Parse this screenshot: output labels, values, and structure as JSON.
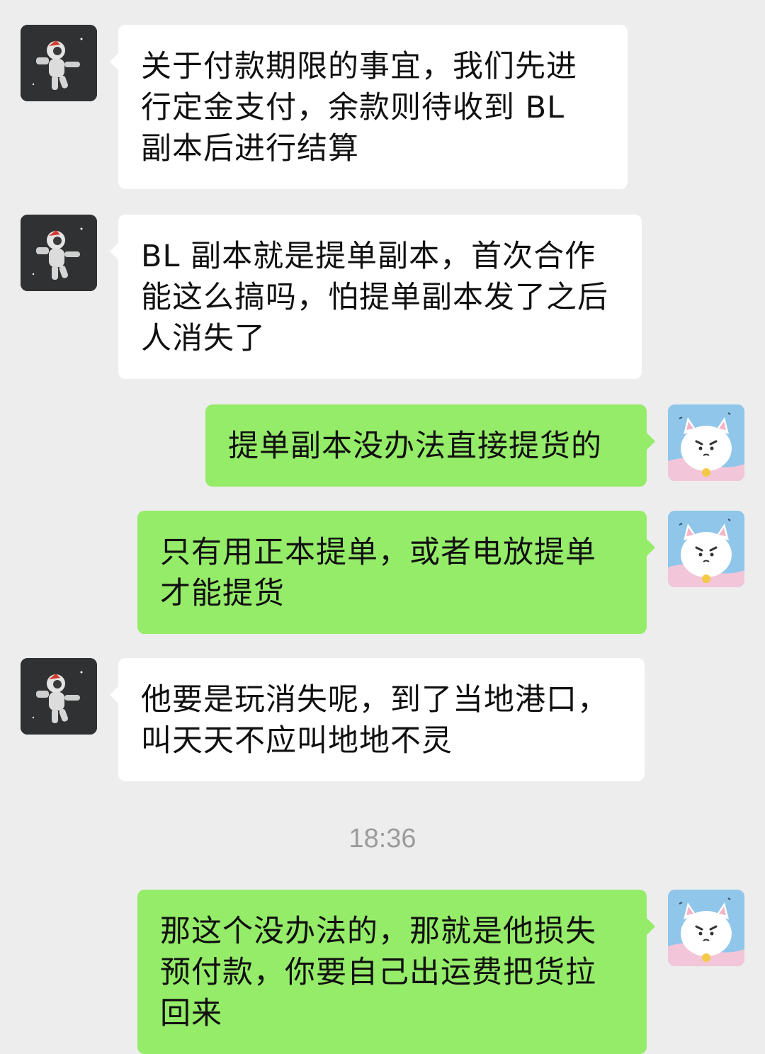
{
  "chat": {
    "messages": [
      {
        "sender": "other",
        "avatar": "astronaut-avatar",
        "text": "关于付款期限的事宜，我们先进行定金支付，余款则待收到 BL 副本后进行结算"
      },
      {
        "sender": "other",
        "avatar": "astronaut-avatar",
        "text": "BL 副本就是提单副本，首次合作能这么搞吗，怕提单副本发了之后人消失了"
      },
      {
        "sender": "self",
        "avatar": "cat-avatar",
        "text": "提单副本没办法直接提货的"
      },
      {
        "sender": "self",
        "avatar": "cat-avatar",
        "text": "只有用正本提单，或者电放提单才能提货"
      },
      {
        "sender": "other",
        "avatar": "astronaut-avatar",
        "text": "他要是玩消失呢，到了当地港口，叫天天不应叫地地不灵"
      },
      {
        "sender": "self",
        "avatar": "cat-avatar",
        "text": "那这个没办法的，那就是他损失预付款，你要自己出运费把货拉回来"
      }
    ],
    "timestamp": "18:36"
  },
  "colors": {
    "background": "#ededed",
    "incoming_bubble": "#ffffff",
    "outgoing_bubble": "#95ec69",
    "timestamp_text": "#9b9b9b"
  }
}
